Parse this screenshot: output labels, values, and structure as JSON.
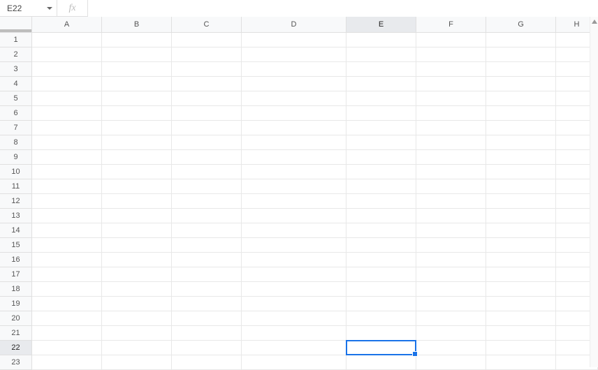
{
  "formula_bar": {
    "cell_ref": "E22",
    "fx_label": "fx",
    "formula_value": ""
  },
  "columns": [
    {
      "label": "A",
      "cls": "col-A",
      "active": false
    },
    {
      "label": "B",
      "cls": "col-B",
      "active": false
    },
    {
      "label": "C",
      "cls": "col-C",
      "active": false
    },
    {
      "label": "D",
      "cls": "col-D",
      "active": false
    },
    {
      "label": "E",
      "cls": "col-E",
      "active": true
    },
    {
      "label": "F",
      "cls": "col-F",
      "active": false
    },
    {
      "label": "G",
      "cls": "col-G",
      "active": false
    },
    {
      "label": "H",
      "cls": "col-H",
      "active": false
    }
  ],
  "rows": [
    {
      "n": "1"
    },
    {
      "n": "2"
    },
    {
      "n": "3"
    },
    {
      "n": "4"
    },
    {
      "n": "5"
    },
    {
      "n": "6"
    },
    {
      "n": "7"
    },
    {
      "n": "8"
    },
    {
      "n": "9"
    },
    {
      "n": "10"
    },
    {
      "n": "11"
    },
    {
      "n": "12"
    },
    {
      "n": "13"
    },
    {
      "n": "14"
    },
    {
      "n": "15"
    },
    {
      "n": "16"
    },
    {
      "n": "17"
    },
    {
      "n": "18"
    },
    {
      "n": "19"
    },
    {
      "n": "20"
    },
    {
      "n": "21"
    },
    {
      "n": "22"
    },
    {
      "n": "23"
    }
  ],
  "selection": {
    "col": 4,
    "row": 21
  }
}
